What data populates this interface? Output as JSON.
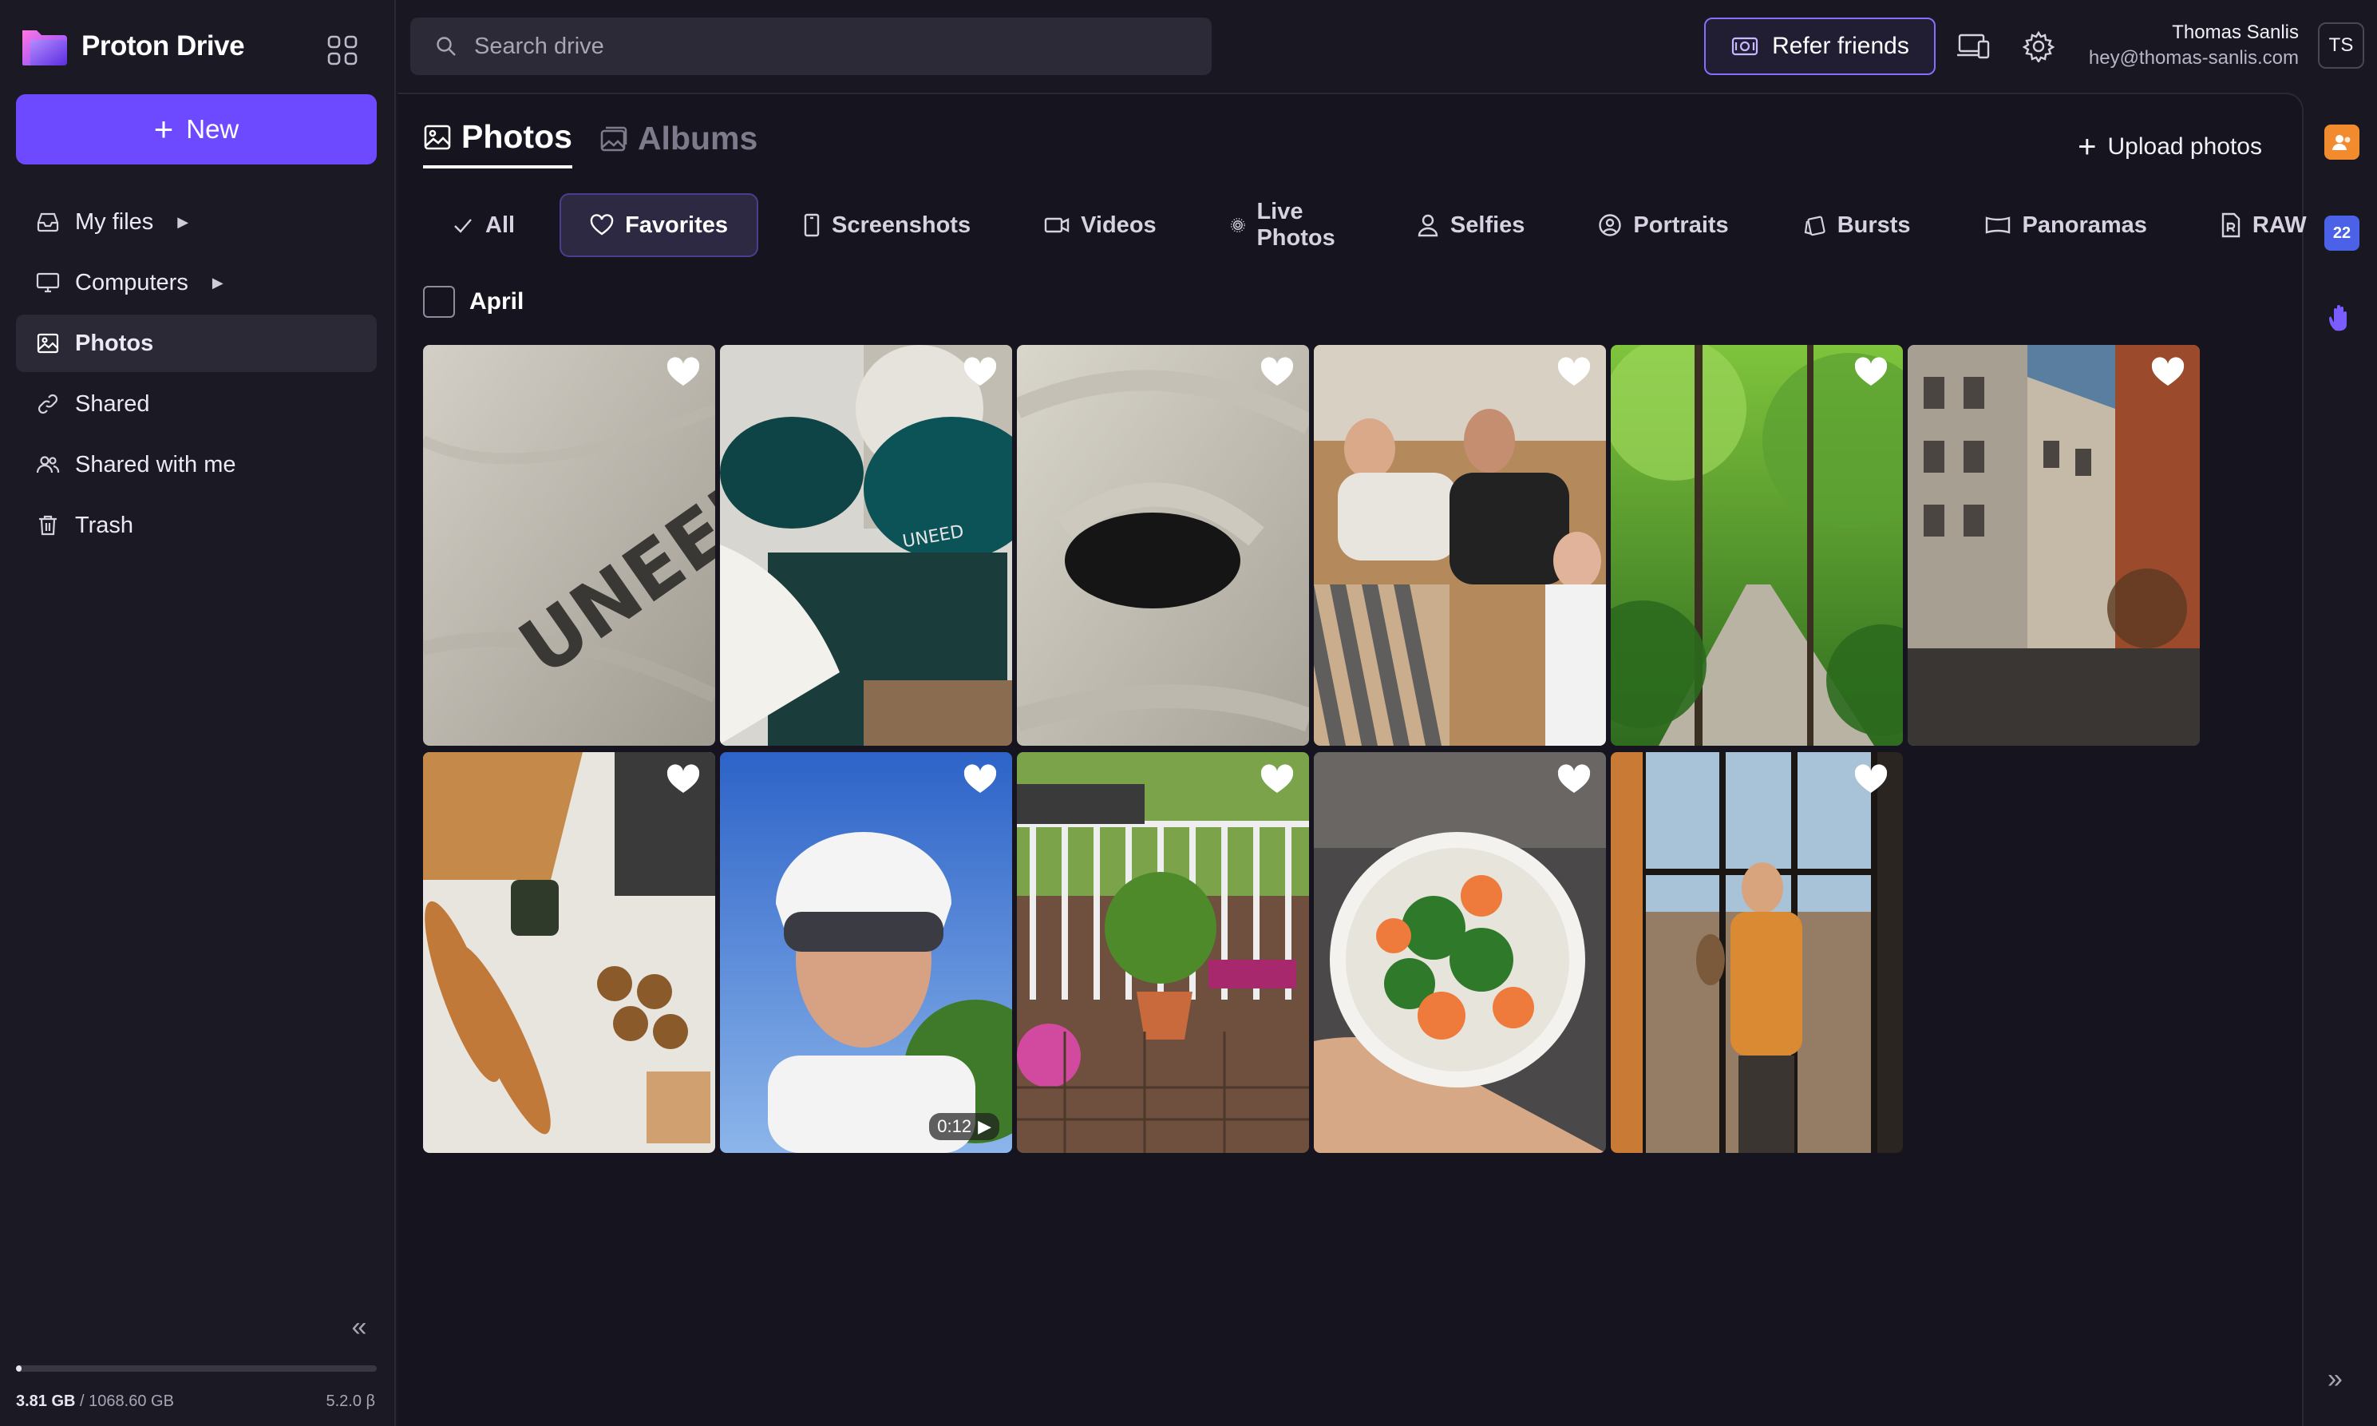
{
  "app": {
    "name": "Proton Drive"
  },
  "sidebar": {
    "new_label": "New",
    "items": [
      {
        "label": "My files",
        "icon": "inbox-icon",
        "caret": true,
        "active": false
      },
      {
        "label": "Computers",
        "icon": "monitor-icon",
        "caret": true,
        "active": false
      },
      {
        "label": "Photos",
        "icon": "image-icon",
        "caret": false,
        "active": true
      },
      {
        "label": "Shared",
        "icon": "link-icon",
        "caret": false,
        "active": false
      },
      {
        "label": "Shared with me",
        "icon": "users-icon",
        "caret": false,
        "active": false
      },
      {
        "label": "Trash",
        "icon": "trash-icon",
        "caret": false,
        "active": false
      }
    ],
    "storage": {
      "used": "3.81 GB",
      "separator": " / ",
      "total": "1068.60 GB",
      "used_fraction": 0.0036
    },
    "version": "5.2.0 β"
  },
  "topbar": {
    "search_placeholder": "Search drive",
    "refer_label": "Refer friends",
    "user": {
      "name": "Thomas Sanlis",
      "email": "hey@thomas-sanlis.com",
      "initials": "TS"
    }
  },
  "main": {
    "tabs": [
      {
        "label": "Photos",
        "active": true
      },
      {
        "label": "Albums",
        "active": false
      }
    ],
    "upload_label": "Upload photos",
    "filters": [
      {
        "label": "All",
        "icon": "check-icon"
      },
      {
        "label": "Favorites",
        "icon": "heart-outline-icon",
        "active": true
      },
      {
        "label": "Screenshots",
        "icon": "phone-icon"
      },
      {
        "label": "Videos",
        "icon": "video-icon"
      },
      {
        "label": "Live Photos",
        "icon": "live-photo-icon"
      },
      {
        "label": "Selfies",
        "icon": "person-icon"
      },
      {
        "label": "Portraits",
        "icon": "portrait-icon"
      },
      {
        "label": "Bursts",
        "icon": "burst-icon"
      },
      {
        "label": "Panoramas",
        "icon": "panorama-icon"
      },
      {
        "label": "RAW",
        "icon": "raw-file-icon"
      }
    ],
    "month": "April",
    "photos": [
      {
        "name": "photo-tshirt-logo",
        "favorite": true
      },
      {
        "name": "photo-caps-and-shirts",
        "favorite": true
      },
      {
        "name": "photo-dog-under-blanket",
        "favorite": true
      },
      {
        "name": "photo-friends-selfie",
        "favorite": true
      },
      {
        "name": "photo-forest-path",
        "favorite": true
      },
      {
        "name": "photo-courtyard-building",
        "favorite": true
      },
      {
        "name": "photo-bread-and-food",
        "favorite": true
      },
      {
        "name": "photo-cyclist-selfie",
        "favorite": true,
        "duration": "0:12"
      },
      {
        "name": "photo-balcony-plants",
        "favorite": true
      },
      {
        "name": "photo-poke-bowl",
        "favorite": true
      },
      {
        "name": "photo-man-by-window",
        "favorite": true
      }
    ]
  },
  "rail": {
    "calendar_day": "22"
  }
}
